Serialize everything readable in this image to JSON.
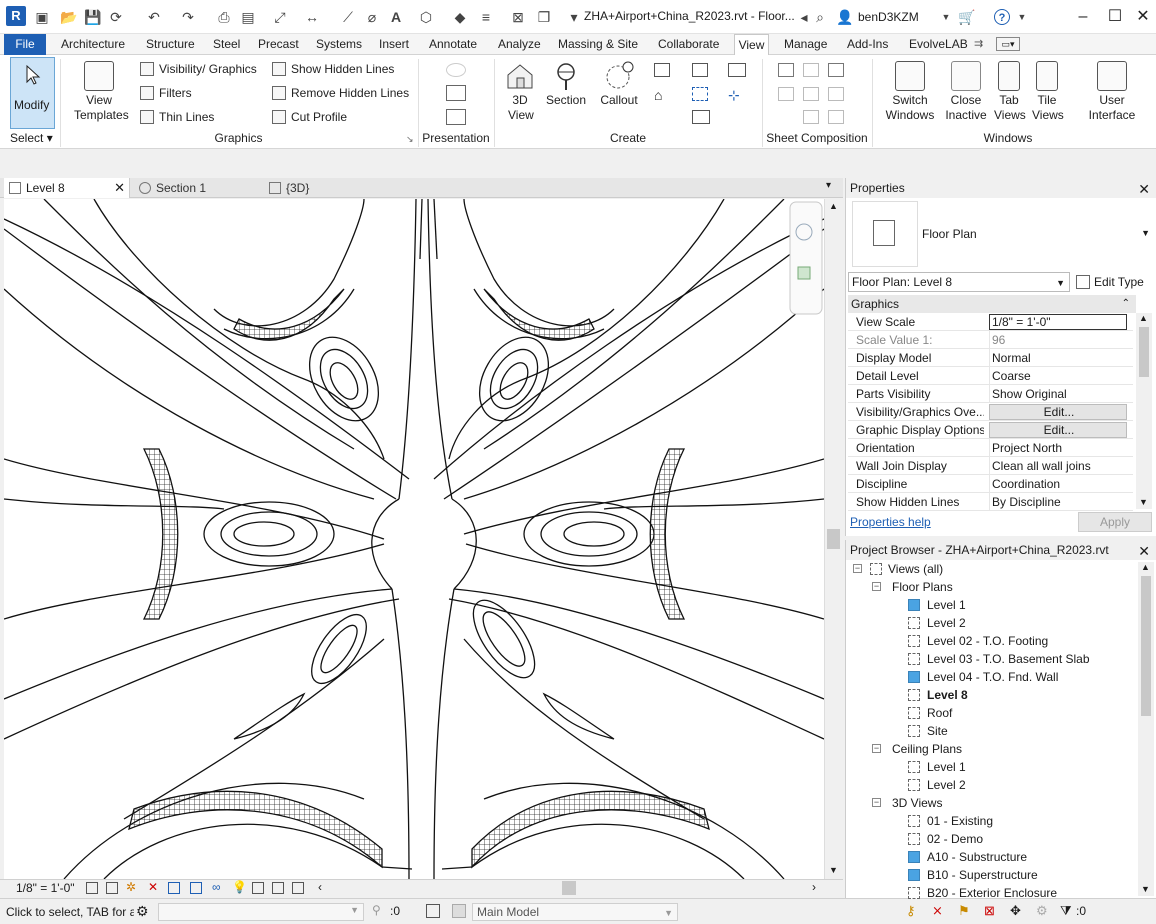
{
  "titlebar": {
    "file_title": "ZHA+Airport+China_R2023.rvt - Floor...",
    "user": "benD3KZM",
    "logo": "R"
  },
  "ribbon_tabs": [
    "File",
    "Architecture",
    "Structure",
    "Steel",
    "Precast",
    "Systems",
    "Insert",
    "Annotate",
    "Analyze",
    "Massing & Site",
    "Collaborate",
    "View",
    "Manage",
    "Add-Ins",
    "EvolveLAB"
  ],
  "active_tab": "View",
  "ribbon": {
    "modify_label": "Modify",
    "select_label": "Select",
    "view_templates_label": "View Templates",
    "visibility_graphics": "Visibility/ Graphics",
    "filters": "Filters",
    "thin_lines": "Thin  Lines",
    "show_hidden_lines": "Show  Hidden Lines",
    "remove_hidden_lines": "Remove  Hidden Lines",
    "cut_profile": "Cut  Profile",
    "graphics_panel": "Graphics",
    "presentation_panel": "Presentation",
    "view_3d": "3D View",
    "section": "Section",
    "callout": "Callout",
    "create_panel": "Create",
    "sheet_composition_panel": "Sheet Composition",
    "switch_windows": "Switch Windows",
    "close_inactive": "Close Inactive",
    "tab_views": "Tab Views",
    "tile_views": "Tile Views",
    "windows_panel": "Windows",
    "user_interface": "User Interface"
  },
  "view_tabs": [
    {
      "label": "Level 8"
    },
    {
      "label": "Section 1"
    },
    {
      "label": "{3D}"
    }
  ],
  "viewbar": {
    "scale": "1/8\" = 1'-0\""
  },
  "status": {
    "hint": "Click to select, TAB for a",
    "worksets": ":0",
    "model": "Main Model",
    "filter_count": ":0"
  },
  "properties": {
    "title": "Properties",
    "type_name": "Floor Plan",
    "instance_selector": "Floor Plan: Level 8",
    "edit_type": "Edit Type",
    "group": "Graphics",
    "rows": [
      {
        "key": "View Scale",
        "value": "1/8\" = 1'-0\""
      },
      {
        "key": "Scale Value    1:",
        "value": "96"
      },
      {
        "key": "Display Model",
        "value": "Normal"
      },
      {
        "key": "Detail Level",
        "value": "Coarse"
      },
      {
        "key": "Parts Visibility",
        "value": "Show Original"
      },
      {
        "key": "Visibility/Graphics Ove...",
        "value": "Edit..."
      },
      {
        "key": "Graphic Display Options",
        "value": "Edit..."
      },
      {
        "key": "Orientation",
        "value": "Project North"
      },
      {
        "key": "Wall Join Display",
        "value": "Clean all wall joins"
      },
      {
        "key": "Discipline",
        "value": "Coordination"
      },
      {
        "key": "Show Hidden Lines",
        "value": "By Discipline"
      }
    ],
    "help_link": "Properties help",
    "apply": "Apply"
  },
  "browser": {
    "title": "Project Browser - ZHA+Airport+China_R2023.rvt",
    "root": "Views (all)",
    "groups": [
      {
        "label": "Floor Plans",
        "items": [
          {
            "label": "Level 1",
            "filled": true
          },
          {
            "label": "Level 2",
            "filled": false
          },
          {
            "label": "Level 02 - T.O. Footing",
            "filled": false
          },
          {
            "label": "Level 03 - T.O. Basement Slab",
            "filled": false
          },
          {
            "label": "Level 04 - T.O. Fnd. Wall",
            "filled": true
          },
          {
            "label": "Level 8",
            "filled": false,
            "bold": true
          },
          {
            "label": "Roof",
            "filled": false
          },
          {
            "label": "Site",
            "filled": false
          }
        ]
      },
      {
        "label": "Ceiling Plans",
        "items": [
          {
            "label": "Level 1",
            "filled": false
          },
          {
            "label": "Level 2",
            "filled": false
          }
        ]
      },
      {
        "label": "3D Views",
        "items": [
          {
            "label": "01 - Existing",
            "filled": false
          },
          {
            "label": "02 - Demo",
            "filled": false
          },
          {
            "label": "A10 - Substructure",
            "filled": true
          },
          {
            "label": "B10 - Superstructure",
            "filled": true
          },
          {
            "label": "B20 - Exterior Enclosure",
            "filled": false
          }
        ]
      }
    ]
  },
  "colors": {
    "accent": "#1e5fb4",
    "selection": "#cde4f7",
    "tree_fill": "#4aa3e2"
  }
}
